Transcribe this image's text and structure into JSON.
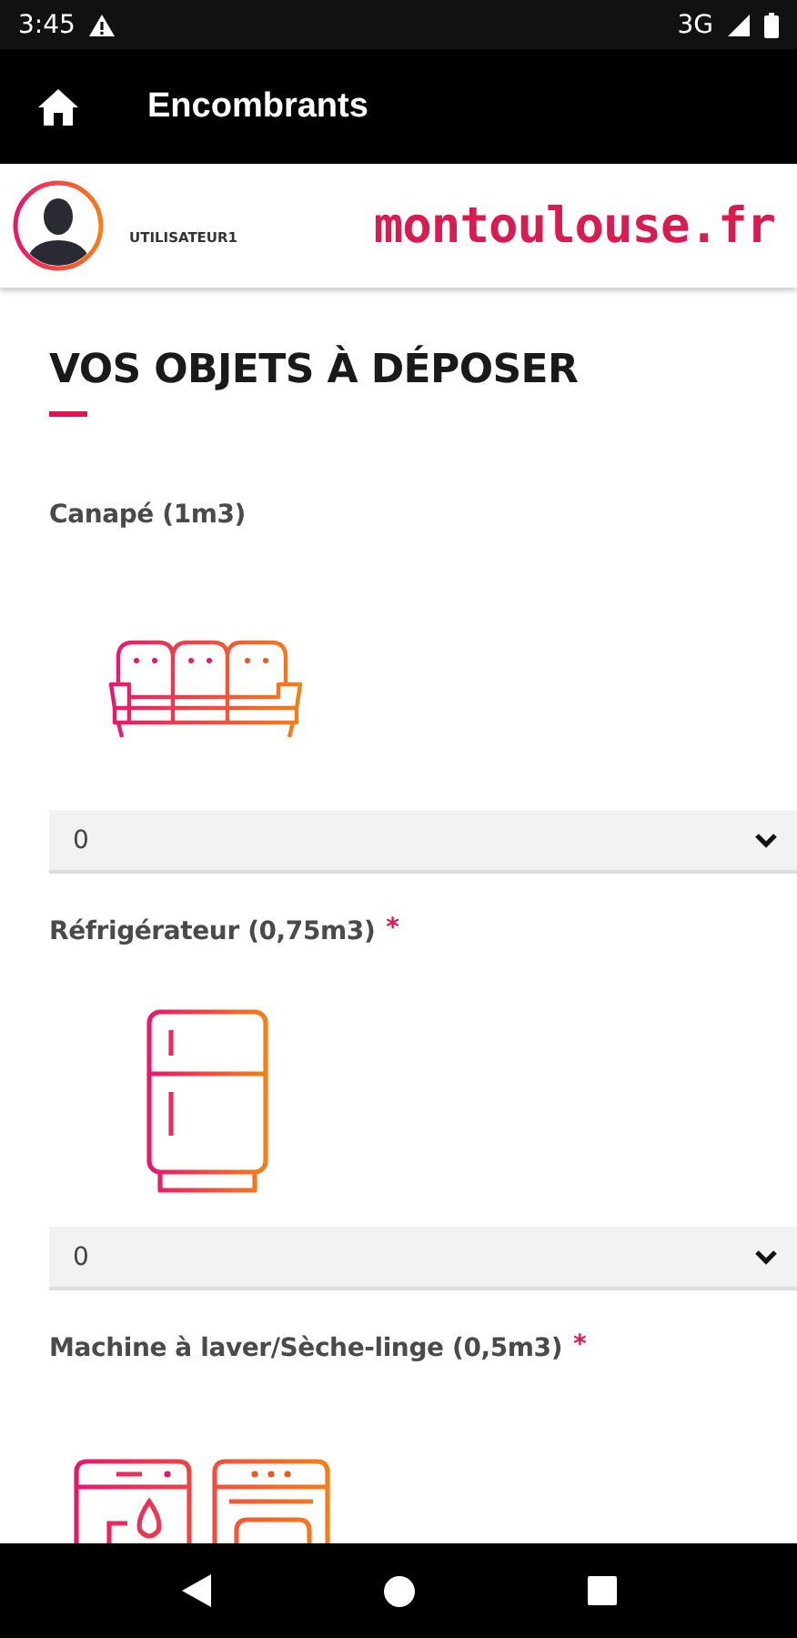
{
  "status_bar": {
    "time": "3:45",
    "network": "3G"
  },
  "app_bar": {
    "title": "Encombrants"
  },
  "header": {
    "username": "UTILISATEUR1",
    "logo": "montoulouse.fr"
  },
  "section": {
    "title": "VOS OBJETS À DÉPOSER"
  },
  "objects": [
    {
      "label": "Canapé (1m3)",
      "kind": "sofa",
      "value": "0"
    },
    {
      "label": "Réfrigérateur (0,75m3)",
      "required_mark": "*",
      "kind": "fridge",
      "value": "0"
    },
    {
      "label": "Machine à laver/Sèche-linge (0,5m3)",
      "required_mark": "*",
      "kind": "washer"
    }
  ]
}
